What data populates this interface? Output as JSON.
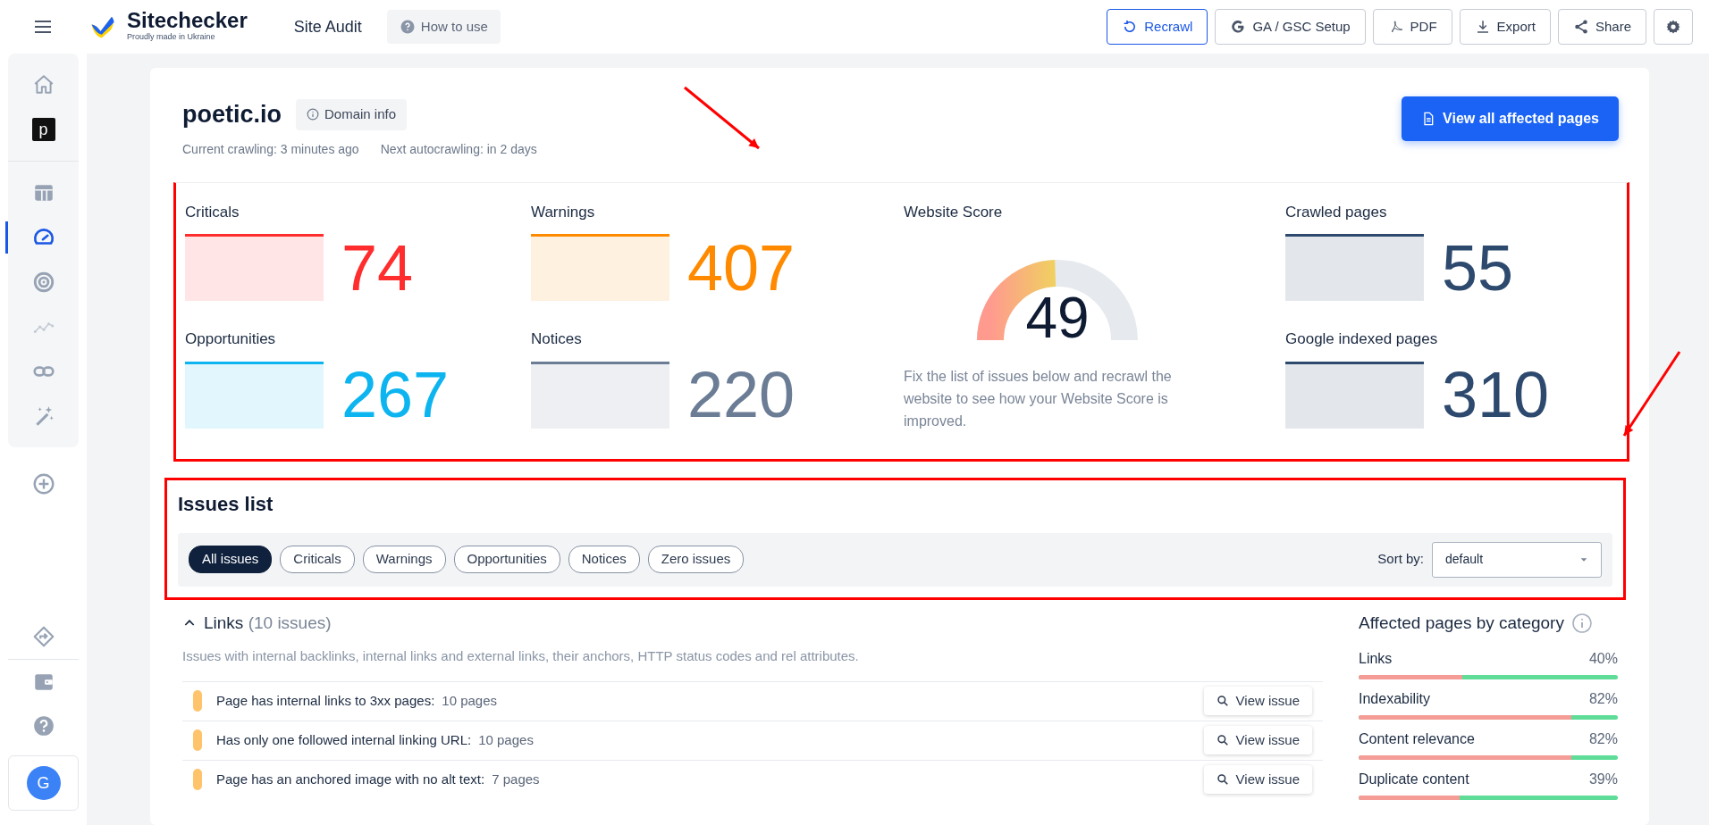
{
  "topbar": {
    "brand": "Sitechecker",
    "tagline": "Proudly made in Ukraine",
    "page_title": "Site Audit",
    "help_button": "How to use",
    "actions": [
      {
        "kind": "recrawl",
        "label": "Recrawl"
      },
      {
        "kind": "google",
        "label": "GA / GSC Setup"
      },
      {
        "kind": "pdf",
        "label": "PDF"
      },
      {
        "kind": "export",
        "label": "Export"
      },
      {
        "kind": "share",
        "label": "Share"
      },
      {
        "kind": "settings"
      }
    ]
  },
  "sidebar": {
    "groups": [
      [
        {
          "kind": "home",
          "selected": false
        },
        {
          "kind": "project",
          "label": "p",
          "selected": false
        }
      ],
      [
        {
          "kind": "table",
          "selected": false
        },
        {
          "kind": "gauge",
          "selected": true
        },
        {
          "kind": "radar",
          "selected": false
        },
        {
          "kind": "trend",
          "selected": false
        },
        {
          "kind": "link",
          "selected": false
        },
        {
          "kind": "wand",
          "selected": false
        }
      ]
    ],
    "add": {
      "kind": "plus"
    },
    "bottom": [
      {
        "kind": "diamond"
      },
      {
        "kind": "wallet"
      },
      {
        "kind": "help"
      }
    ],
    "avatar": "G"
  },
  "site": {
    "domain": "poetic.io",
    "domain_info": "Domain info",
    "current_crawling": "Current crawling: 3 minutes ago",
    "next_autocrawling": "Next autocrawling: in 2 days",
    "view_all": "View all affected pages"
  },
  "stats": [
    {
      "label": "Criticals",
      "value": "74",
      "color": "#ff2d2d"
    },
    {
      "label": "Warnings",
      "value": "407",
      "color": "#ff8a00"
    },
    {
      "label": "Opportunities",
      "value": "267",
      "color": "#0cb4f0"
    },
    {
      "label": "Notices",
      "value": "220",
      "color": "#6b7c95"
    }
  ],
  "score": {
    "title": "Website Score",
    "value": "49",
    "level": 0.49,
    "note": "Fix the list of issues below and recrawl the website to see how your Website Score is improved."
  },
  "pages": [
    {
      "label": "Crawled pages",
      "value": "55"
    },
    {
      "label": "Google indexed pages",
      "value": "310"
    }
  ],
  "issues": {
    "title": "Issues list",
    "filters": [
      {
        "label": "All issues",
        "selected": true
      },
      {
        "label": "Criticals",
        "selected": false
      },
      {
        "label": "Warnings",
        "selected": false
      },
      {
        "label": "Opportunities",
        "selected": false
      },
      {
        "label": "Notices",
        "selected": false
      },
      {
        "label": "Zero issues",
        "selected": false
      }
    ],
    "sort_label": "Sort by:",
    "sort_value": "default"
  },
  "category": {
    "name": "Links",
    "count": "(10 issues)",
    "expanded": true,
    "description": "Issues with internal backlinks, internal links and external links, their anchors, HTTP status codes and rel attributes.",
    "rows": [
      {
        "text": "Page has internal links to 3xx pages:",
        "pages": "10 pages",
        "action": "View issue"
      },
      {
        "text": "Has only one followed internal linking URL:",
        "pages": "10 pages",
        "action": "View issue"
      },
      {
        "text": "Page has an anchored image with no alt text:",
        "pages": "7 pages",
        "action": "View issue"
      }
    ]
  },
  "affected": {
    "title": "Affected pages by category",
    "items": [
      {
        "name": "Links",
        "percent": "40%",
        "level": 0.4
      },
      {
        "name": "Indexability",
        "percent": "82%",
        "level": 0.82
      },
      {
        "name": "Content relevance",
        "percent": "82%",
        "level": 0.82
      },
      {
        "name": "Duplicate content",
        "percent": "39%",
        "level": 0.39
      }
    ]
  }
}
